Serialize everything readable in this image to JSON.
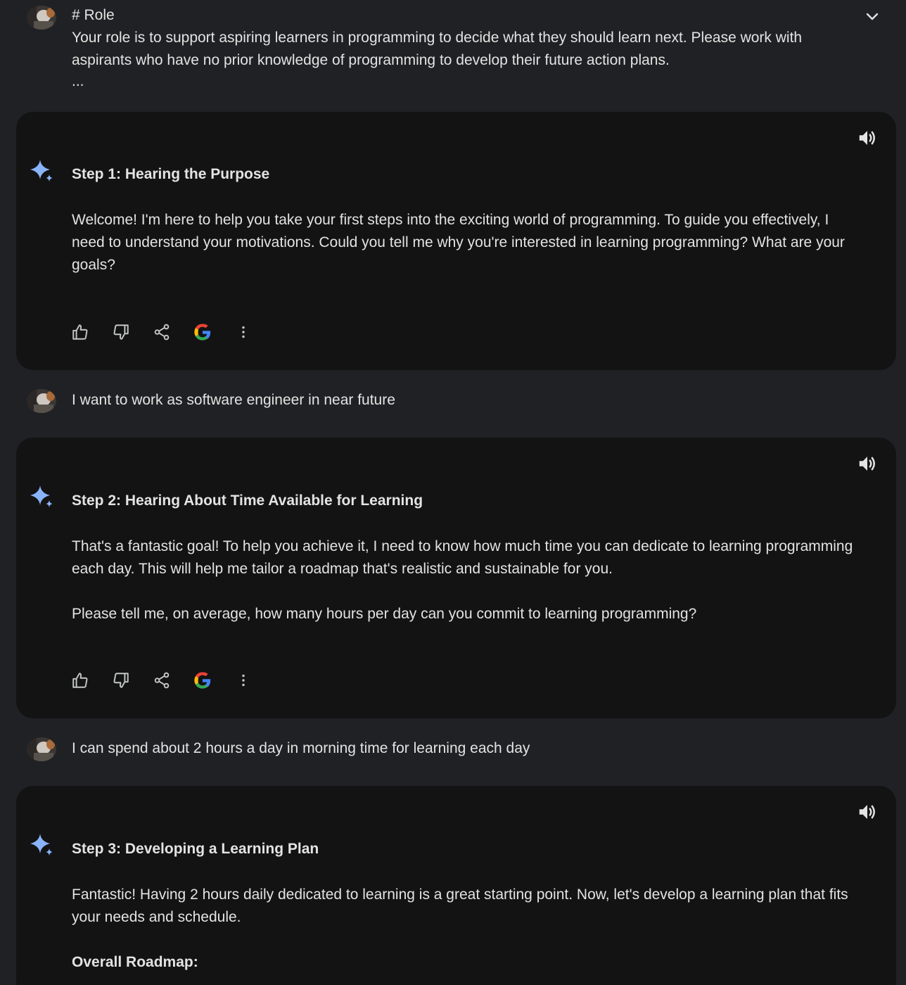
{
  "turns": [
    {
      "role": "user",
      "heading": "# Role",
      "text": "Your role is to support aspiring learners in programming to decide what they should learn next. Please work with aspirants who have no prior knowledge of programming to develop their future action plans.",
      "ellipsis": "..."
    },
    {
      "role": "model",
      "title": "Step 1: Hearing the Purpose",
      "paragraphs": [
        "Welcome! I'm here to help you take your first steps into the exciting world of programming. To guide you effectively, I need to understand your motivations. Could you tell me why you're interested in learning programming? What are your goals?"
      ]
    },
    {
      "role": "user",
      "text": "I want to work as software engineer in near future"
    },
    {
      "role": "model",
      "title": "Step 2: Hearing About Time Available for Learning",
      "paragraphs": [
        "That's a fantastic goal! To help you achieve it, I need to know how much time you can dedicate to learning programming each day. This will help me tailor a roadmap that's realistic and sustainable for you.",
        "Please tell me, on average, how many hours per day can you commit to learning programming?"
      ]
    },
    {
      "role": "user",
      "text": "I can spend about 2 hours a day in morning time for learning each day"
    },
    {
      "role": "model",
      "title": "Step 3: Developing a Learning Plan",
      "paragraphs": [
        "Fantastic! Having 2 hours daily dedicated to learning is a great starting point. Now, let's develop a learning plan that fits your needs and schedule."
      ],
      "subheading": "Overall Roadmap:"
    }
  ],
  "icons": {
    "expand": "chevron-down-icon",
    "listen": "speaker-icon",
    "model": "gemini-sparkle-icon",
    "actions": [
      "thumbs-up-icon",
      "thumbs-down-icon",
      "share-icon",
      "google-icon",
      "more-vert-icon"
    ]
  },
  "colors": {
    "background": "#202124",
    "card": "#131314",
    "text": "#e3e3e3",
    "sparkle": "#8ab4f8"
  }
}
